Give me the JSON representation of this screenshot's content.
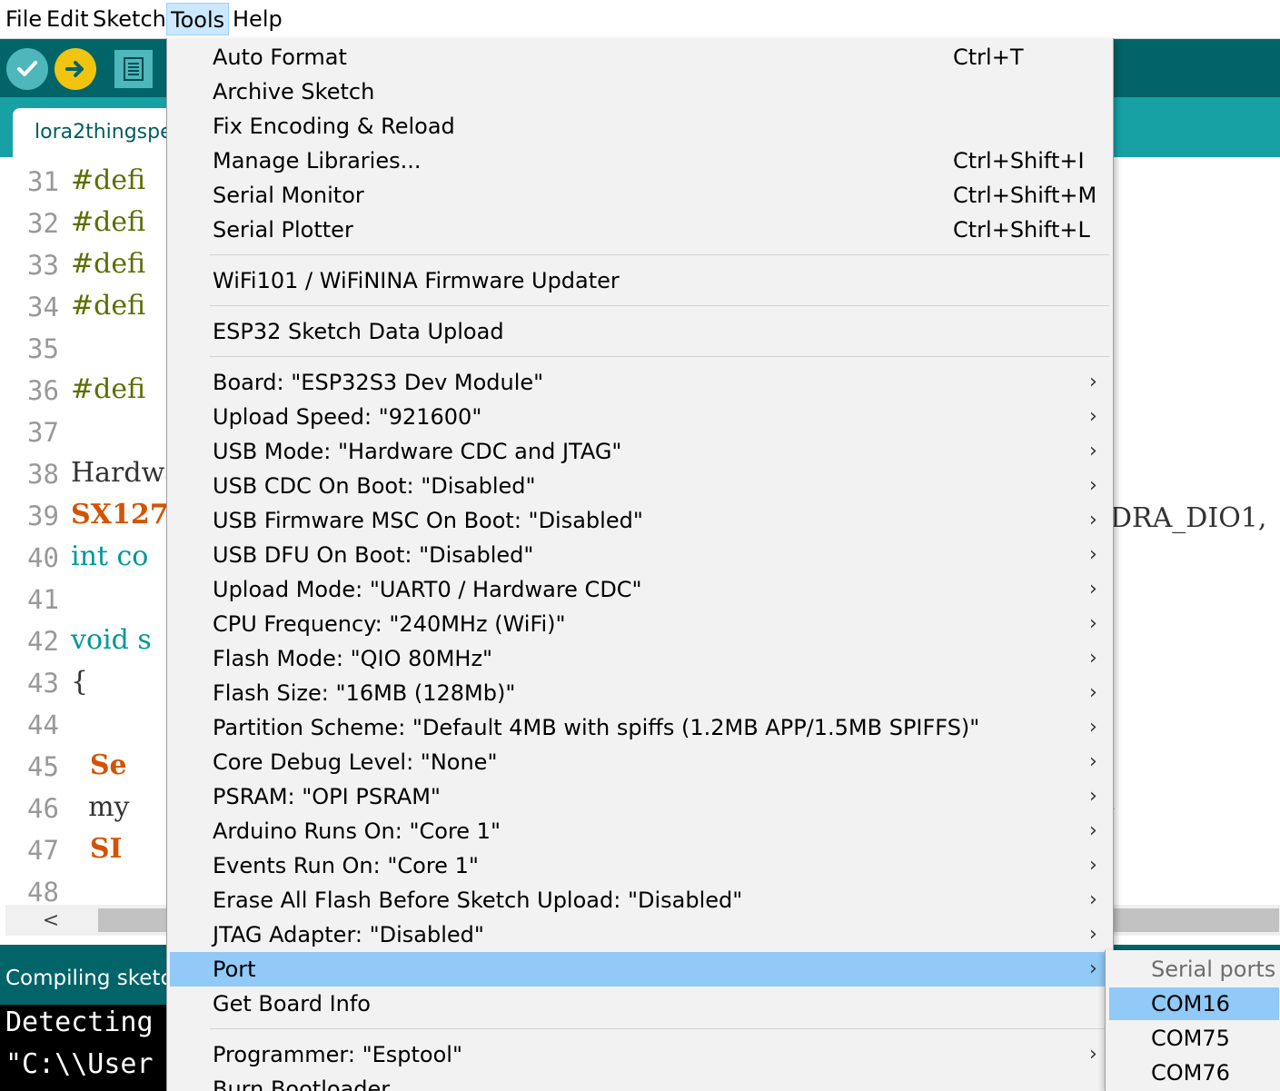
{
  "menubar": {
    "items": [
      "File",
      "Edit",
      "Sketch",
      "Tools",
      "Help"
    ],
    "active": "Tools"
  },
  "toolbar": {
    "verify_icon": "checkmark-icon",
    "upload_icon": "arrow-right-icon",
    "new_icon": "document-icon",
    "colors": {
      "bar": "#006468",
      "verify": "#4db7bb",
      "upload": "#f1c40f"
    }
  },
  "tab": {
    "label": "lora2thingspe"
  },
  "editor": {
    "lines": [
      {
        "n": "31",
        "text": "#defi",
        "kind": "def"
      },
      {
        "n": "32",
        "text": "#defi",
        "kind": "def"
      },
      {
        "n": "33",
        "text": "#defi",
        "kind": "def"
      },
      {
        "n": "34",
        "text": "#defi",
        "kind": "def"
      },
      {
        "n": "35",
        "text": "",
        "kind": "plain"
      },
      {
        "n": "36",
        "text": "#defi",
        "kind": "def"
      },
      {
        "n": "37",
        "text": "",
        "kind": "plain"
      },
      {
        "n": "38",
        "text": "Hardwa",
        "kind": "plain"
      },
      {
        "n": "39",
        "text": "SX127",
        "kind": "cls"
      },
      {
        "n": "40",
        "text": "int co",
        "kind": "type"
      },
      {
        "n": "41",
        "text": "",
        "kind": "plain"
      },
      {
        "n": "42",
        "text": "void s",
        "kind": "type"
      },
      {
        "n": "43",
        "text": "{",
        "kind": "plain"
      },
      {
        "n": "44",
        "text": "",
        "kind": "plain"
      },
      {
        "n": "45",
        "text": "  Se",
        "kind": "cls"
      },
      {
        "n": "46",
        "text": "  my",
        "kind": "plain"
      },
      {
        "n": "47",
        "text": "  SI",
        "kind": "cls"
      },
      {
        "n": "48",
        "text": "",
        "kind": "plain"
      }
    ],
    "right_fragment_39": "DRA_DIO1,",
    "right_fragment_46": ";"
  },
  "hscroll": {
    "left_arrow": "<"
  },
  "console": {
    "status": "Compiling sketch",
    "lines": [
      "Detecting",
      "\"C:\\\\User"
    ]
  },
  "dropdown": {
    "items": [
      {
        "label": "Auto Format",
        "shortcut": "Ctrl+T"
      },
      {
        "label": "Archive Sketch"
      },
      {
        "label": "Fix Encoding & Reload"
      },
      {
        "label": "Manage Libraries...",
        "shortcut": "Ctrl+Shift+I"
      },
      {
        "label": "Serial Monitor",
        "shortcut": "Ctrl+Shift+M"
      },
      {
        "label": "Serial Plotter",
        "shortcut": "Ctrl+Shift+L"
      },
      {
        "sep": true
      },
      {
        "label": "WiFi101 / WiFiNINA Firmware Updater"
      },
      {
        "sep": true
      },
      {
        "label": "ESP32 Sketch Data Upload"
      },
      {
        "sep": true
      },
      {
        "label": "Board: \"ESP32S3 Dev Module\"",
        "submenu": true
      },
      {
        "label": "Upload Speed: \"921600\"",
        "submenu": true
      },
      {
        "label": "USB Mode: \"Hardware CDC and JTAG\"",
        "submenu": true
      },
      {
        "label": "USB CDC On Boot: \"Disabled\"",
        "submenu": true
      },
      {
        "label": "USB Firmware MSC On Boot: \"Disabled\"",
        "submenu": true
      },
      {
        "label": "USB DFU On Boot: \"Disabled\"",
        "submenu": true
      },
      {
        "label": "Upload Mode: \"UART0 / Hardware CDC\"",
        "submenu": true
      },
      {
        "label": "CPU Frequency: \"240MHz (WiFi)\"",
        "submenu": true
      },
      {
        "label": "Flash Mode: \"QIO 80MHz\"",
        "submenu": true
      },
      {
        "label": "Flash Size: \"16MB (128Mb)\"",
        "submenu": true
      },
      {
        "label": "Partition Scheme: \"Default 4MB with spiffs (1.2MB APP/1.5MB SPIFFS)\"",
        "submenu": true
      },
      {
        "label": "Core Debug Level: \"None\"",
        "submenu": true
      },
      {
        "label": "PSRAM: \"OPI PSRAM\"",
        "submenu": true
      },
      {
        "label": "Arduino Runs On: \"Core 1\"",
        "submenu": true
      },
      {
        "label": "Events Run On: \"Core 1\"",
        "submenu": true
      },
      {
        "label": "Erase All Flash Before Sketch Upload: \"Disabled\"",
        "submenu": true
      },
      {
        "label": "JTAG Adapter: \"Disabled\"",
        "submenu": true
      },
      {
        "label": "Port",
        "submenu": true,
        "highlighted": true
      },
      {
        "label": "Get Board Info"
      },
      {
        "sep": true
      },
      {
        "label": "Programmer: \"Esptool\"",
        "submenu": true
      },
      {
        "label": "Burn Bootloader"
      }
    ],
    "arrow_glyph": "›",
    "highlight_color": "#91c9f7"
  },
  "submenu": {
    "header": "Serial ports",
    "ports": [
      "COM16",
      "COM75",
      "COM76"
    ],
    "selected": "COM16"
  }
}
